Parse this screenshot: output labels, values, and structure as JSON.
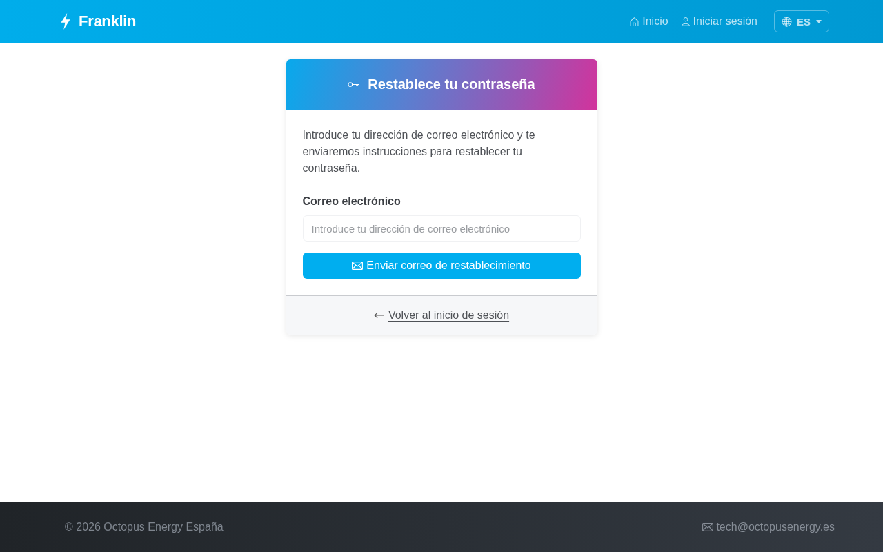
{
  "navbar": {
    "brand": "Franklin",
    "home_link": {
      "label": "Inicio"
    },
    "login_link": {
      "label": "Iniciar sesión"
    },
    "language_menu": {
      "label": "ES"
    }
  },
  "card": {
    "title": "Restablece tu contraseña",
    "intro": "Introduce tu dirección de correo electrónico y te enviaremos instrucciones para restablecer tu contraseña.",
    "email_field": {
      "label": "Correo electrónico",
      "placeholder": "Introduce tu dirección de correo electrónico"
    },
    "submit_button": {
      "label": "Enviar correo de restablecimiento"
    },
    "back_link": {
      "label": "Volver al inicio de sesión"
    }
  },
  "footer": {
    "copyright": "© 2026 Octopus Energy España",
    "contact_email": "tech@octopusenergy.es"
  }
}
